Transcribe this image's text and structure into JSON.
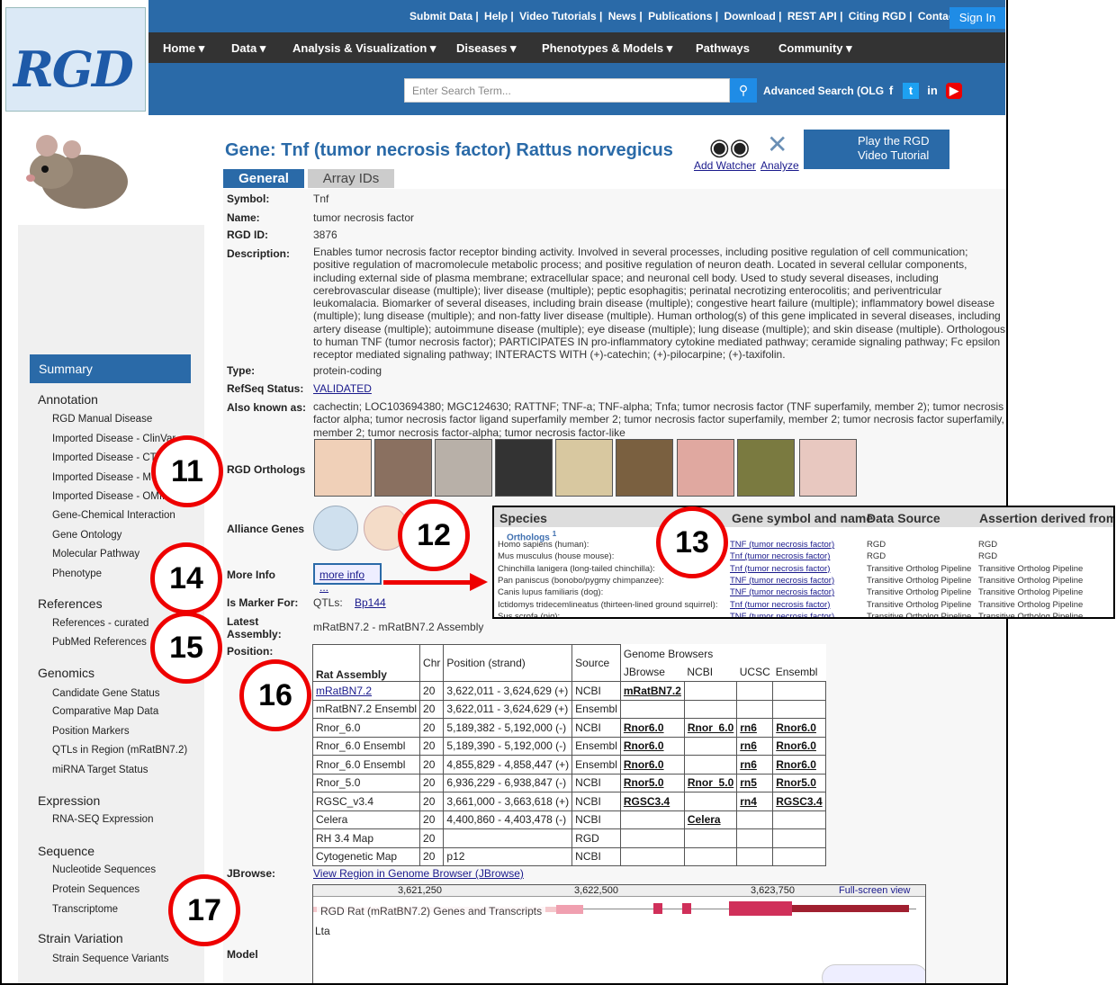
{
  "header": {
    "logo": "RGD",
    "links": [
      "Submit Data |",
      "Help |",
      "Video Tutorials |",
      "News |",
      "Publications |",
      "Download |",
      "REST API |",
      "Citing RGD |",
      "Contact"
    ],
    "sign_in": "Sign In",
    "nav": [
      "Home ▾",
      "Data ▾",
      "Analysis & Visualization ▾",
      "Diseases ▾",
      "Phenotypes & Models ▾",
      "Pathways",
      "Community ▾"
    ],
    "search_placeholder": "Enter Search Term...",
    "advanced": "Advanced Search (OLG"
  },
  "gene": {
    "title": "Gene: Tnf (tumor necrosis factor) Rattus norvegicus",
    "add_watcher": "Add Watcher",
    "analyze": "Analyze",
    "tutorial": "Play the RGD Video Tutorial",
    "tabs": [
      "General",
      "Array IDs"
    ]
  },
  "fields": {
    "symbol_label": "Symbol:",
    "symbol": "Tnf",
    "name_label": "Name:",
    "name": "tumor necrosis factor",
    "rgd_label": "RGD ID:",
    "rgd": "3876",
    "desc_label": "Description:",
    "description": "Enables tumor necrosis factor receptor binding activity. Involved in several processes, including positive regulation of cell communication; positive regulation of macromolecule metabolic process; and positive regulation of neuron death. Located in several cellular components, including external side of plasma membrane; extracellular space; and neuronal cell body. Used to study several diseases, including cerebrovascular disease (multiple); liver disease (multiple); peptic esophagitis; perinatal necrotizing enterocolitis; and periventricular leukomalacia. Biomarker of several diseases, including brain disease (multiple); congestive heart failure (multiple); inflammatory bowel disease (multiple); lung disease (multiple); and non-fatty liver disease (multiple). Human ortholog(s) of this gene implicated in several diseases, including artery disease (multiple); autoimmune disease (multiple); eye disease (multiple); lung disease (multiple); and skin disease (multiple). Orthologous to human TNF (tumor necrosis factor); PARTICIPATES IN pro-inflammatory cytokine mediated pathway; ceramide signaling pathway; Fc epsilon receptor mediated signaling pathway; INTERACTS WITH (+)-catechin; (+)-pilocarpine; (+)-taxifolin.",
    "type_label": "Type:",
    "type": "protein-coding",
    "refseq_label": "RefSeq Status:",
    "refseq": "VALIDATED",
    "aka_label": "Also known as:",
    "aka": "cachectin; LOC103694380; MGC124630; RATTNF; TNF-a; TNF-alpha; Tnfa; tumor necrosis factor (TNF superfamily, member 2); tumor necrosis factor alpha; tumor necrosis factor ligand superfamily member 2; tumor necrosis factor superfamily, member 2; tumor necrosis factor superfamily, member 2; tumor necrosis factor-alpha; tumor necrosis factor-like",
    "orth_label": "RGD Orthologs",
    "alliance_label": "Alliance Genes",
    "more_label": "More Info",
    "more_btn": "more info ...",
    "marker_label": "Is Marker For:",
    "marker_qtl": "QTLs:",
    "marker_val": "Bp144",
    "assembly_label": "Latest Assembly:",
    "assembly": "mRatBN7.2 - mRatBN7.2 Assembly",
    "position_label": "Position:",
    "jbrowse_label": "JBrowse:",
    "jbrowse_link": "View Region in Genome Browser (JBrowse)",
    "model_label": "Model"
  },
  "sidebar": {
    "summary": "Summary",
    "sections": [
      {
        "h": "Annotation",
        "items": [
          "RGD Manual Disease",
          "Imported Disease - ClinVar",
          "Imported Disease - CTD",
          "Imported Disease - MGI",
          "Imported Disease - OMIM",
          "Gene-Chemical Interaction",
          "Gene Ontology",
          "Molecular Pathway",
          "Phenotype"
        ]
      },
      {
        "h": "References",
        "items": [
          "References - curated",
          "PubMed References"
        ]
      },
      {
        "h": "Genomics",
        "items": [
          "Candidate Gene Status",
          "Comparative Map Data",
          "Position Markers",
          "QTLs in Region (mRatBN7.2)",
          "miRNA Target Status"
        ]
      },
      {
        "h": "Expression",
        "items": [
          "RNA-SEQ Expression"
        ]
      },
      {
        "h": "Sequence",
        "items": [
          "Nucleotide Sequences",
          "Protein Sequences",
          "Transcriptome"
        ]
      },
      {
        "h": "Strain Variation",
        "items": [
          "Strain Sequence Variants"
        ]
      }
    ]
  },
  "popup": {
    "headers": [
      "Species",
      "Gene symbol and name",
      "Data Source",
      "Assertion derived from"
    ],
    "orthologs": "Orthologs",
    "orthologs_sup": "1",
    "rows": [
      [
        "Homo sapiens (human):",
        "TNF (tumor necrosis factor)",
        "RGD",
        "RGD"
      ],
      [
        "Mus musculus (house mouse):",
        "Tnf (tumor necrosis factor)",
        "RGD",
        "RGD"
      ],
      [
        "Chinchilla lanigera (long-tailed chinchilla):",
        "Tnf (tumor necrosis factor)",
        "Transitive Ortholog Pipeline",
        "Transitive Ortholog Pipeline"
      ],
      [
        "Pan paniscus (bonobo/pygmy chimpanzee):",
        "TNF (tumor necrosis factor)",
        "Transitive Ortholog Pipeline",
        "Transitive Ortholog Pipeline"
      ],
      [
        "Canis lupus familiaris (dog):",
        "TNF (tumor necrosis factor)",
        "Transitive Ortholog Pipeline",
        "Transitive Ortholog Pipeline"
      ],
      [
        "Ictidomys tridecemlineatus (thirteen-lined ground squirrel):",
        "Tnf (tumor necrosis factor)",
        "Transitive Ortholog Pipeline",
        "Transitive Ortholog Pipeline"
      ],
      [
        "Sus scrofa (pig):",
        "TNF (tumor necrosis factor)",
        "Transitive Ortholog Pipeline",
        "Transitive Ortholog Pipeline"
      ]
    ]
  },
  "position_table": {
    "gb_header": "Genome Browsers",
    "headers": [
      "Rat Assembly",
      "Chr",
      "Position (strand)",
      "Source",
      "JBrowse",
      "NCBI",
      "UCSC",
      "Ensembl"
    ],
    "rows": [
      [
        "mRatBN7.2",
        "20",
        "3,622,011 - 3,624,629 (+)",
        "NCBI",
        "mRatBN7.2",
        "",
        "",
        ""
      ],
      [
        "mRatBN7.2 Ensembl",
        "20",
        "3,622,011 - 3,624,629 (+)",
        "Ensembl",
        "",
        "",
        "",
        ""
      ],
      [
        "Rnor_6.0",
        "20",
        "5,189,382 - 5,192,000 (-)",
        "NCBI",
        "Rnor6.0",
        "Rnor_6.0",
        "rn6",
        "Rnor6.0"
      ],
      [
        "Rnor_6.0 Ensembl",
        "20",
        "5,189,390 - 5,192,000 (-)",
        "Ensembl",
        "Rnor6.0",
        "",
        "rn6",
        "Rnor6.0"
      ],
      [
        "Rnor_6.0 Ensembl",
        "20",
        "4,855,829 - 4,858,447 (+)",
        "Ensembl",
        "Rnor6.0",
        "",
        "rn6",
        "Rnor6.0"
      ],
      [
        "Rnor_5.0",
        "20",
        "6,936,229 - 6,938,847 (-)",
        "NCBI",
        "Rnor5.0",
        "Rnor_5.0",
        "rn5",
        "Rnor5.0"
      ],
      [
        "RGSC_v3.4",
        "20",
        "3,661,000 - 3,663,618 (+)",
        "NCBI",
        "RGSC3.4",
        "",
        "rn4",
        "RGSC3.4"
      ],
      [
        "Celera",
        "20",
        "4,400,860 - 4,403,478 (-)",
        "NCBI",
        "",
        "Celera",
        "",
        ""
      ],
      [
        "RH 3.4 Map",
        "20",
        "",
        "RGD",
        "",
        "",
        "",
        ""
      ],
      [
        "Cytogenetic Map",
        "20",
        "p12",
        "NCBI",
        "",
        "",
        "",
        ""
      ]
    ]
  },
  "jbrowse": {
    "ticks": [
      "3,621,250",
      "3,622,500",
      "3,623,750"
    ],
    "fullscreen": "Full-screen view",
    "track": "RGD Rat (mRatBN7.2) Genes and Transcripts",
    "gene": "Lta"
  },
  "callouts": [
    "11",
    "12",
    "13",
    "14",
    "15",
    "16",
    "17"
  ]
}
